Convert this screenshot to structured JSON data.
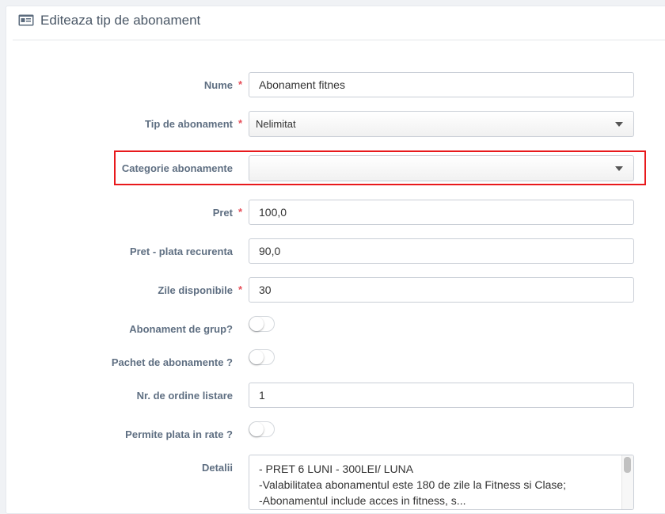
{
  "header": {
    "title": "Editeaza tip de abonament",
    "icon": "id-card-icon"
  },
  "form": {
    "nume": {
      "label": "Nume",
      "required": "*",
      "value": "Abonament fitnes"
    },
    "tip": {
      "label": "Tip de abonament",
      "required": "*",
      "value": "Nelimitat"
    },
    "categorie": {
      "label": "Categorie abonamente",
      "value": ""
    },
    "pret": {
      "label": "Pret",
      "required": "*",
      "value": "100,0"
    },
    "pret_recurent": {
      "label": "Pret - plata recurenta",
      "value": "90,0"
    },
    "zile": {
      "label": "Zile disponibile",
      "required": "*",
      "value": "30"
    },
    "grup": {
      "label": "Abonament de grup?",
      "on": false
    },
    "pachet": {
      "label": "Pachet de abonamente ?",
      "on": false
    },
    "ordine": {
      "label": "Nr. de ordine listare",
      "value": "1"
    },
    "rate": {
      "label": "Permite plata in rate ?",
      "on": false
    },
    "detalii": {
      "label": "Detalii",
      "lines": [
        "- PRET 6 LUNI - 300LEI/ LUNA",
        "-Valabilitatea abonamentul este 180 de zile la Fitness si Clase;",
        "-Abonamentul include acces in fitness, s..."
      ]
    }
  },
  "colors": {
    "highlight": "#e8191c",
    "required": "#e7505a",
    "label": "#5f6f82"
  }
}
